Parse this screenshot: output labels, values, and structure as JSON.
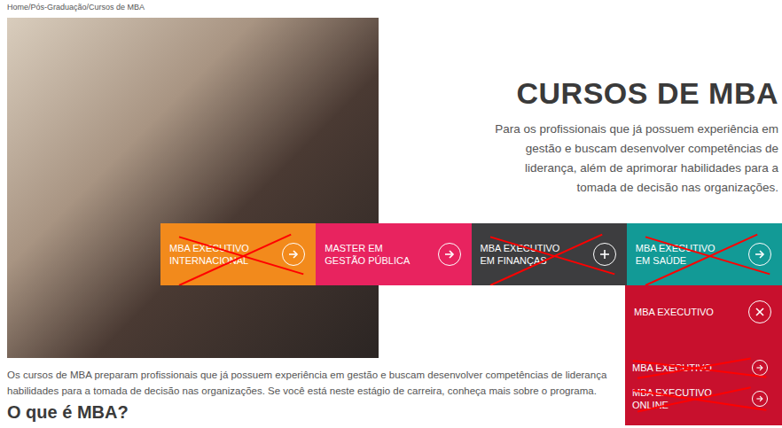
{
  "breadcrumb": "Home/Pós-Graduação/Cursos de MBA",
  "hero": {
    "title": "CURSOS DE MBA",
    "lines": [
      "Para os profissionais que já possuem experiência em",
      "gestão e buscam desenvolver competências de",
      "liderança, além de aprimorar habilidades para a",
      "tomada de decisão nas organizações."
    ]
  },
  "courses": [
    {
      "label": "MBA EXECUTIVO INTERNACIONAL",
      "kind": "arrow",
      "color": "#f28a1c",
      "crossed": true
    },
    {
      "label": "MASTER EM GESTÃO PÚBLICA",
      "kind": "arrow",
      "color": "#e8235f",
      "crossed": false
    },
    {
      "label": "MBA EXECUTIVO EM FINANÇAS",
      "kind": "plus",
      "color": "#3d3d3f",
      "crossed": true
    },
    {
      "label": "MBA EXECUTIVO EM SAÚDE",
      "kind": "arrow",
      "color": "#129a96",
      "crossed": true
    }
  ],
  "dropdown": {
    "title": "MBA EXECUTIVO",
    "expanded": true,
    "items": [
      {
        "label": "MBA EXECUTIVO",
        "crossed": true
      },
      {
        "label": "MBA EXECUTIVO ONLINE",
        "crossed": true
      }
    ]
  },
  "intro": [
    "Os cursos de MBA preparam profissionais que já possuem experiência em gestão e buscam desenvolver competências de liderança",
    "habilidades para a tomada de decisão nas organizações. Se você está neste estágio de carreira, conheça mais sobre o programa."
  ],
  "section_title": "O que é MBA?"
}
